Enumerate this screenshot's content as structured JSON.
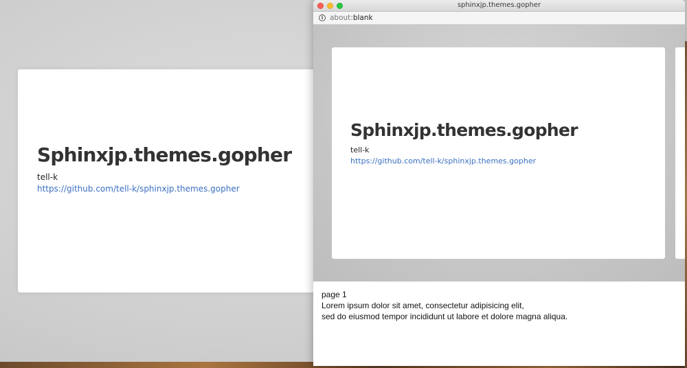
{
  "background_slide": {
    "title": "Sphinxjp.themes.gopher",
    "author": "tell-k",
    "link": "https://github.com/tell-k/sphinxjp.themes.gopher"
  },
  "window": {
    "title": "sphinxjp.themes.gopher",
    "url_scheme": "about:",
    "url_rest": "blank"
  },
  "current_slide": {
    "title": "Sphinxjp.themes.gopher",
    "author": "tell-k",
    "link": "https://github.com/tell-k/sphinxjp.themes.gopher"
  },
  "notes": {
    "page": "page 1",
    "line1": "Lorem ipsum dolor sit amet, consectetur adipisicing elit,",
    "line2": "sed do eiusmod tempor incididunt ut labore et dolore magna aliqua."
  },
  "icons": [
    "close-icon",
    "minimize-icon",
    "maximize-icon",
    "info-icon"
  ]
}
